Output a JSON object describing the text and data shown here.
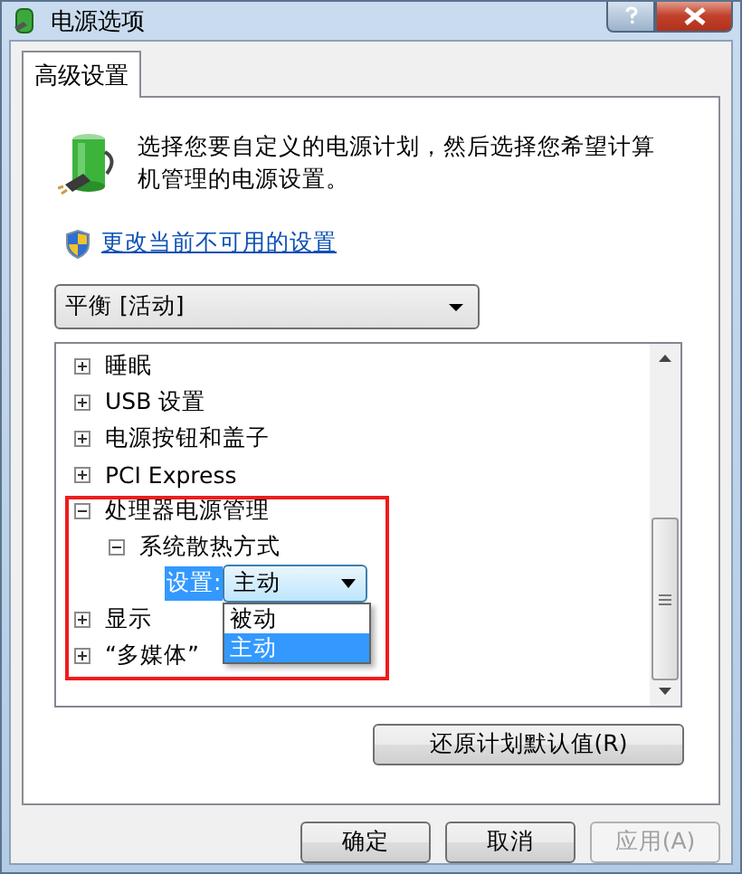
{
  "window": {
    "title": "电源选项"
  },
  "tabs": [
    {
      "label": "高级设置",
      "selected": true
    }
  ],
  "intro": "选择您要自定义的电源计划，然后选择您希望计算机管理的电源设置。",
  "admin_link": "更改当前不可用的设置",
  "plan_select": {
    "value": "平衡 [活动]"
  },
  "tree": [
    {
      "label": "睡眠",
      "expanded": false
    },
    {
      "label": "USB 设置",
      "expanded": false
    },
    {
      "label": "电源按钮和盖子",
      "expanded": false
    },
    {
      "label": "PCI Express",
      "expanded": false
    },
    {
      "label": "处理器电源管理",
      "expanded": true,
      "annotated": true,
      "children": [
        {
          "label": "系统散热方式",
          "expanded": true,
          "children": [
            {
              "kind": "setting",
              "label": "设置:",
              "selected": true,
              "value": "主动",
              "open": true,
              "options": [
                {
                  "label": "被动",
                  "selected": false
                },
                {
                  "label": "主动",
                  "selected": true
                }
              ]
            }
          ]
        }
      ]
    },
    {
      "label": "显示",
      "expanded": false
    },
    {
      "label": "“多媒体”",
      "expanded": false
    }
  ],
  "restore_button": "还原计划默认值(R)",
  "buttons": [
    {
      "label": "确定",
      "disabled": false
    },
    {
      "label": "取消",
      "disabled": false
    },
    {
      "label": "应用(A)",
      "disabled": true
    }
  ]
}
